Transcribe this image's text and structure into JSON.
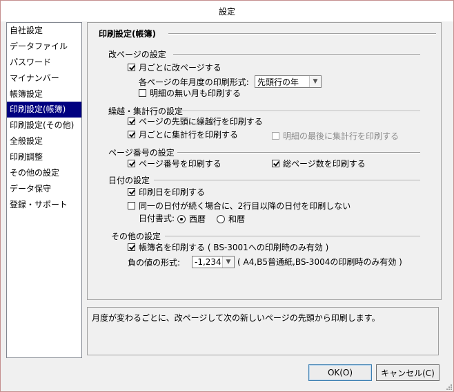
{
  "window": {
    "title": "設定"
  },
  "sidebar": {
    "items": [
      {
        "label": "自社設定",
        "selected": false
      },
      {
        "label": "データファイル",
        "selected": false
      },
      {
        "label": "パスワード",
        "selected": false
      },
      {
        "label": "マイナンバー",
        "selected": false
      },
      {
        "label": "帳簿設定",
        "selected": false
      },
      {
        "label": "印刷設定(帳簿)",
        "selected": true
      },
      {
        "label": "印刷設定(その他)",
        "selected": false
      },
      {
        "label": "全般設定",
        "selected": false
      },
      {
        "label": "印刷調整",
        "selected": false
      },
      {
        "label": "その他の設定",
        "selected": false
      },
      {
        "label": "データ保守",
        "selected": false
      },
      {
        "label": "登録・サポート",
        "selected": false
      }
    ]
  },
  "main": {
    "title": "印刷設定(帳簿)",
    "page_break": {
      "title": "改ページの設定",
      "monthly_break": {
        "label": "月ごとに改ページする",
        "checked": true
      },
      "year_format_label": "各ページの年月度の印刷形式:",
      "year_format_value": "先頭行の年",
      "print_empty_month": {
        "label": "明細の無い月も印刷する",
        "checked": false
      }
    },
    "carry": {
      "title": "繰越・集計行の設定",
      "carry_top": {
        "label": "ページの先頭に繰越行を印刷する",
        "checked": true
      },
      "monthly_total": {
        "label": "月ごとに集計行を印刷する",
        "checked": true
      },
      "total_last": {
        "label": "明細の最後に集計行を印刷する",
        "checked": false,
        "disabled": true
      }
    },
    "page_number": {
      "title": "ページ番号の設定",
      "print_page_no": {
        "label": "ページ番号を印刷する",
        "checked": true
      },
      "print_total_pages": {
        "label": "総ページ数を印刷する",
        "checked": true
      }
    },
    "date": {
      "title": "日付の設定",
      "print_date": {
        "label": "印刷日を印刷する",
        "checked": true
      },
      "same_date": {
        "label": "同一の日付が続く場合に、2行目以降の日付を印刷しない",
        "checked": false
      },
      "format_label": "日付書式:",
      "options": [
        {
          "label": "西暦",
          "selected": true
        },
        {
          "label": "和暦",
          "selected": false
        }
      ]
    },
    "other": {
      "title": "その他の設定",
      "print_book_name": {
        "label": "帳簿名を印刷する ( BS-3001への印刷時のみ有効 )",
        "checked": true
      },
      "negative_label": "負の値の形式:",
      "negative_value": "-1,234",
      "negative_note": "( A4,B5普通紙,BS-3004の印刷時のみ有効 )"
    }
  },
  "description": "月度が変わるごとに、改ページして次の新しいページの先頭から印刷します。",
  "buttons": {
    "ok": "OK(O)",
    "cancel": "キャンセル(C)"
  }
}
